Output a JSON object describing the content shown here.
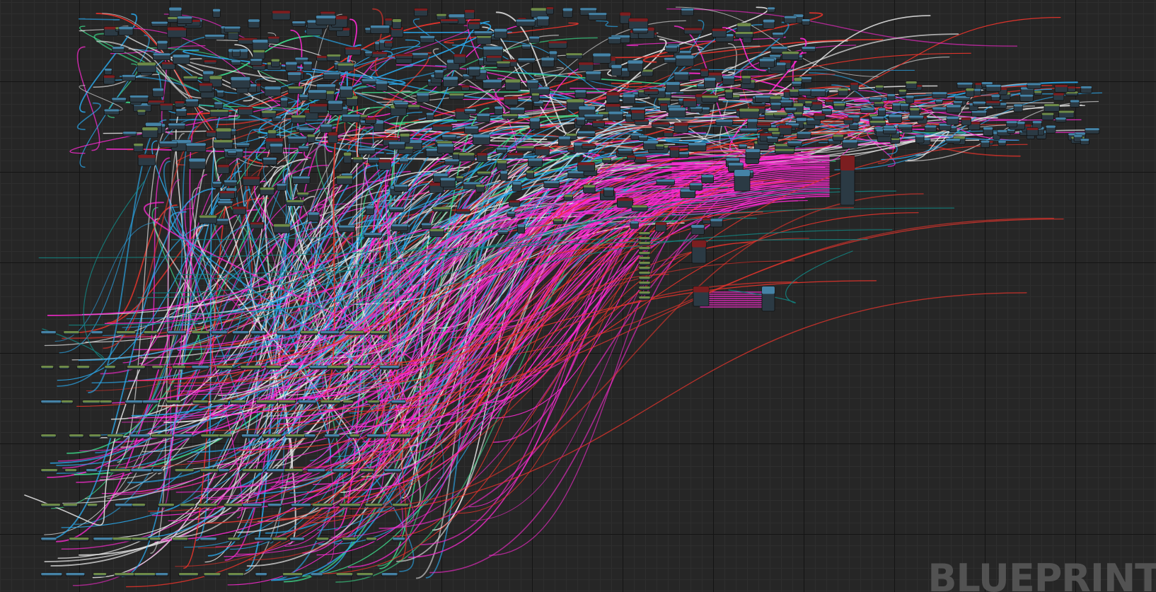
{
  "watermark": {
    "text": "BLUEPRINT"
  },
  "colors": {
    "background": "#262626",
    "grid_major": "#141414",
    "grid_minor": "#2e2e2e",
    "exec_wire": "#e6e6e6",
    "object_wire": "#2aa6e8",
    "string_wire": "#ff2ad4",
    "bool_wire": "#e8342c",
    "float_wire": "#3ee08e",
    "struct_wire": "#128a86",
    "node_body": "#2b3a44",
    "node_header_blue": "#4a90b8",
    "node_header_green": "#7a9a4a",
    "node_header_red": "#8a1a1a",
    "watermark": "#5a5a5a"
  }
}
